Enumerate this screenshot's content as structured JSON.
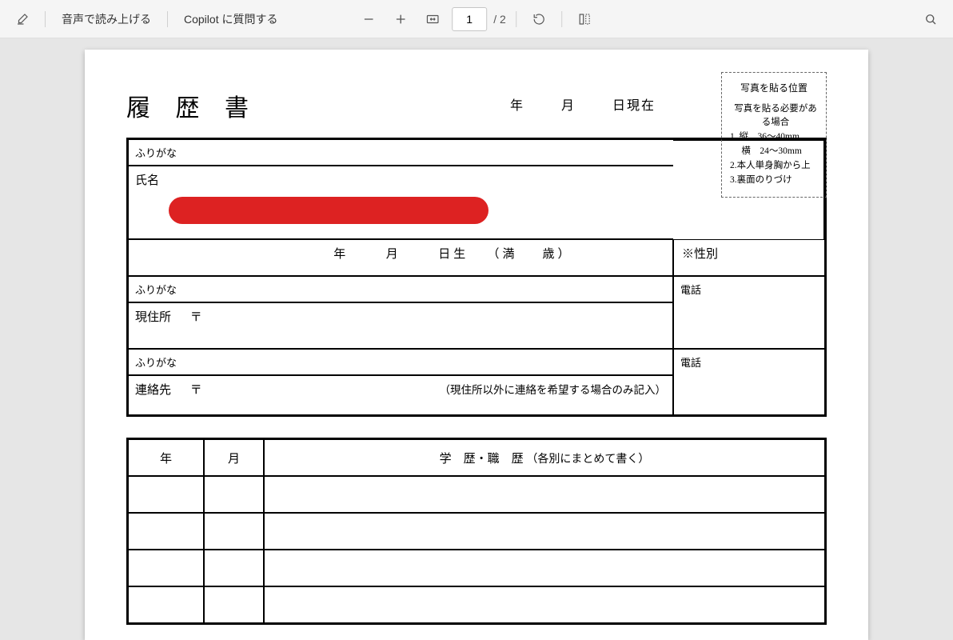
{
  "toolbar": {
    "read_aloud": "音声で読み上げる",
    "ask_copilot": "Copilot に質問する",
    "page_current": "1",
    "page_total": "/ 2"
  },
  "doc": {
    "title": "履 歴 書",
    "date": {
      "year": "年",
      "month": "月",
      "day_suffix": "日現在"
    },
    "photo": {
      "title": "写真を貼る位置",
      "cond": "写真を貼る必要がある場合",
      "l1": "1.  縦　36～40mm",
      "l1b": "　  横　24～30mm",
      "l2": "2.本人単身胸から上",
      "l3": "3.裏面のりづけ"
    },
    "furigana": "ふりがな",
    "name_label": "氏名",
    "dob": {
      "year": "年",
      "month": "月",
      "day_birth": "日生",
      "age_open": "（満",
      "age_unit": "歳）"
    },
    "gender_label": "※性別",
    "tel_label": "電話",
    "address_label": "現住所",
    "postal_mark": "〒",
    "contact_label": "連絡先",
    "contact_note": "（現住所以外に連絡を希望する場合のみ記入）",
    "history": {
      "year": "年",
      "month": "月",
      "main_heading": "学　歴・職　歴",
      "main_note": "（各別にまとめて書く）"
    }
  }
}
